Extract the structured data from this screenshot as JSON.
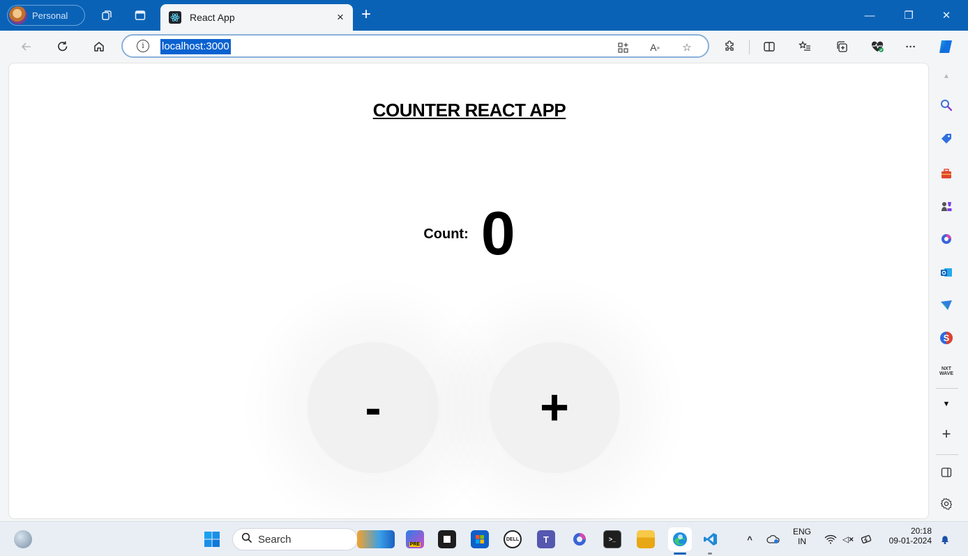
{
  "browser": {
    "profile_label": "Personal",
    "tab_title": "React App",
    "new_tab_symbol": "+",
    "close_tab_symbol": "×",
    "url": "localhost:3000",
    "window_controls": {
      "minimize": "—",
      "restore": "❐",
      "close": "✕"
    },
    "more_symbol": "···"
  },
  "app": {
    "title": "COUNTER REACT APP",
    "count_label": "Count:",
    "count_value": "0",
    "decrement_label": "-",
    "increment_label": "+"
  },
  "taskbar": {
    "search_placeholder": "Search",
    "lang_top": "ENG",
    "lang_bottom": "IN",
    "time": "20:18",
    "date": "09-01-2024"
  },
  "colors": {
    "titlebar": "#0a62b6",
    "url_highlight": "#0a62d0",
    "button_bg": "#f1f1f1"
  }
}
